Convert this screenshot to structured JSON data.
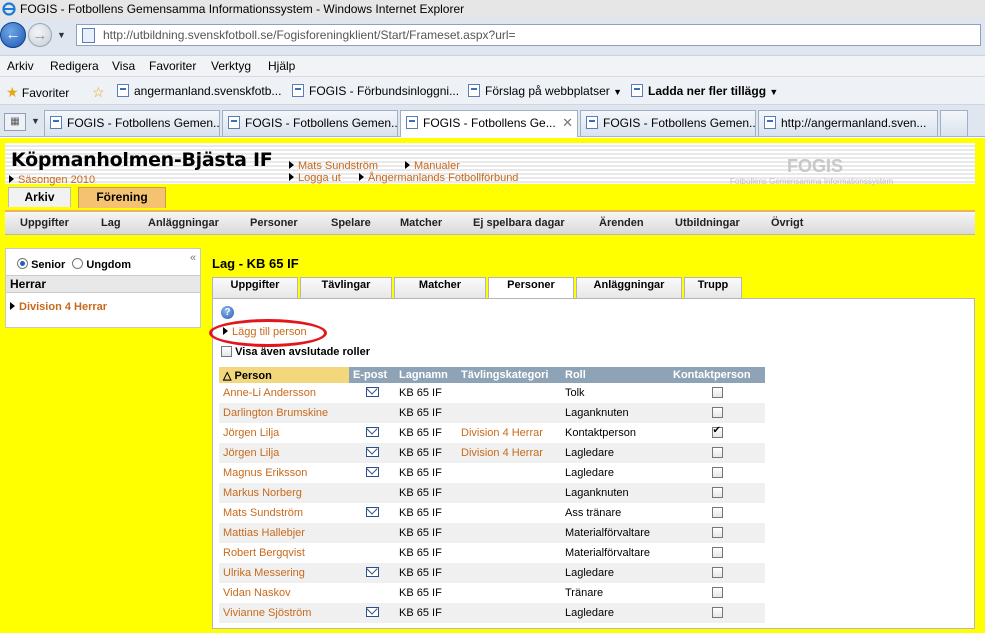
{
  "window": {
    "title": "FOGIS - Fotbollens Gemensamma Informationssystem - Windows Internet Explorer"
  },
  "address": {
    "url": "http://utbildning.svenskfotboll.se/Fogisforeningklient/Start/Frameset.aspx?url="
  },
  "menu": [
    "Arkiv",
    "Redigera",
    "Visa",
    "Favoriter",
    "Verktyg",
    "Hjälp"
  ],
  "favorites": {
    "label": "Favoriter",
    "items": [
      "angermanland.svenskfotb...",
      "FOGIS - Förbundsinloggni...",
      "Förslag på webbplatser",
      "Ladda ner fler tillägg"
    ]
  },
  "browser_tabs": [
    {
      "label": "FOGIS - Fotbollens Gemen..."
    },
    {
      "label": "FOGIS - Fotbollens Gemen..."
    },
    {
      "label": "FOGIS - Fotbollens Ge...",
      "close": "✕"
    },
    {
      "label": "FOGIS - Fotbollens Gemen..."
    },
    {
      "label": "http://angermanland.sven..."
    }
  ],
  "header": {
    "club": "Köpmanholmen-Bjästa IF",
    "season": "Säsongen 2010",
    "user": "Mats Sundström",
    "manuals": "Manualer",
    "logout": "Logga ut",
    "federation": "Ångermanlands Fotbollförbund",
    "logo": "FOGIS",
    "logo_sub": "Fotbollens Gemensamma Informationssystem"
  },
  "module_tabs": {
    "arkiv": "Arkiv",
    "forening": "Förening"
  },
  "main_nav": [
    "Uppgifter",
    "Lag",
    "Anläggningar",
    "Personer",
    "Spelare",
    "Matcher",
    "Ej spelbara dagar",
    "Ärenden",
    "Utbildningar",
    "Övrigt"
  ],
  "left_panel": {
    "senior": "Senior",
    "ungdom": "Ungdom",
    "collapse": "«",
    "group": "Herrar",
    "division": "Division 4 Herrar"
  },
  "team": {
    "title": "Lag - KB 65 IF"
  },
  "content_tabs": [
    "Uppgifter",
    "Tävlingar",
    "Matcher",
    "Personer",
    "Anläggningar",
    "Trupp"
  ],
  "actions": {
    "help": "?",
    "add_person": "Lägg till person",
    "show_ended": "Visa även avslutade roller"
  },
  "table": {
    "columns": [
      "Person",
      "E-post",
      "Lagnamn",
      "Tävlingskategori",
      "Roll",
      "Kontaktperson"
    ],
    "sort_indicator": "△",
    "rows": [
      {
        "person": "Anne-Li Andersson",
        "email": true,
        "team": "KB 65 IF",
        "category": "",
        "role": "Tolk",
        "contact": false
      },
      {
        "person": "Darlington Brumskine",
        "email": false,
        "team": "KB 65 IF",
        "category": "",
        "role": "Laganknuten",
        "contact": false
      },
      {
        "person": "Jörgen Lilja",
        "email": true,
        "team": "KB 65 IF",
        "category": "Division 4 Herrar",
        "role": "Kontaktperson",
        "contact": true
      },
      {
        "person": "Jörgen Lilja",
        "email": true,
        "team": "KB 65 IF",
        "category": "Division 4 Herrar",
        "role": "Lagledare",
        "contact": false
      },
      {
        "person": "Magnus Eriksson",
        "email": true,
        "team": "KB 65 IF",
        "category": "",
        "role": "Lagledare",
        "contact": false
      },
      {
        "person": "Markus Norberg",
        "email": false,
        "team": "KB 65 IF",
        "category": "",
        "role": "Laganknuten",
        "contact": false
      },
      {
        "person": "Mats Sundström",
        "email": true,
        "team": "KB 65 IF",
        "category": "",
        "role": "Ass tränare",
        "contact": false
      },
      {
        "person": "Mattias Hallebjer",
        "email": false,
        "team": "KB 65 IF",
        "category": "",
        "role": "Materialförvaltare",
        "contact": false
      },
      {
        "person": "Robert Bergqvist",
        "email": false,
        "team": "KB 65 IF",
        "category": "",
        "role": "Materialförvaltare",
        "contact": false
      },
      {
        "person": "Ulrika Messering",
        "email": true,
        "team": "KB 65 IF",
        "category": "",
        "role": "Lagledare",
        "contact": false
      },
      {
        "person": "Vidan Naskov",
        "email": false,
        "team": "KB 65 IF",
        "category": "",
        "role": "Tränare",
        "contact": false
      },
      {
        "person": "Vivianne Sjöström",
        "email": true,
        "team": "KB 65 IF",
        "category": "",
        "role": "Lagledare",
        "contact": false
      }
    ]
  }
}
